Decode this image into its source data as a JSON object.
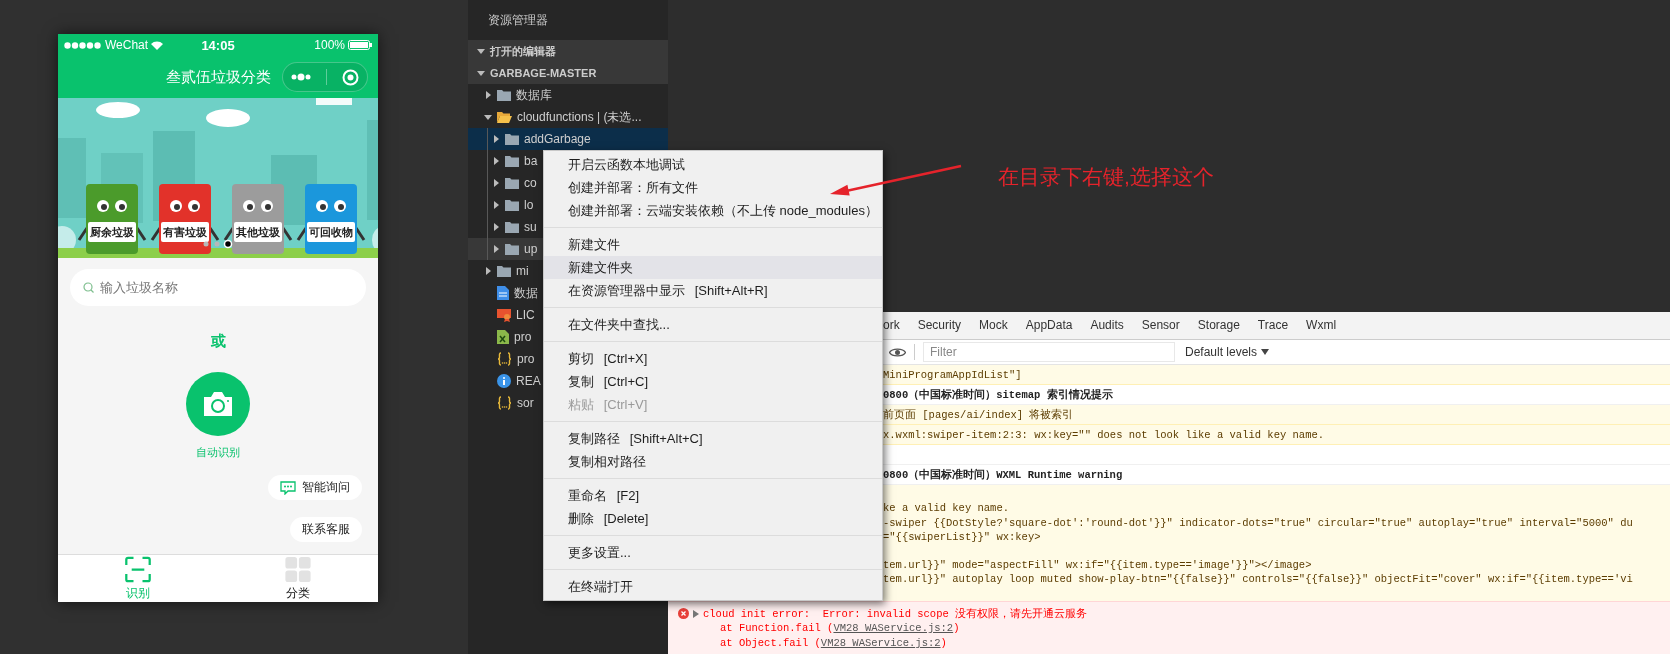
{
  "phone": {
    "status_bar": {
      "carrier": "WeChat",
      "time": "14:05",
      "battery": "100%"
    },
    "title": "叁贰伍垃圾分类",
    "banner": {
      "bins": [
        {
          "label": "厨余垃圾",
          "color": "#4b9b2b"
        },
        {
          "label": "有害垃圾",
          "color": "#e2322a"
        },
        {
          "label": "其他垃圾",
          "color": "#9c9c9c"
        },
        {
          "label": "可回收物",
          "color": "#1b97dc"
        }
      ],
      "dots": [
        {
          "selected": false
        },
        {
          "selected": false
        },
        {
          "selected": true
        }
      ]
    },
    "search": {
      "placeholder": "输入垃圾名称"
    },
    "or_text": "或",
    "camera_label": "自动识别",
    "float_buttons": [
      {
        "kind": "chat",
        "label": "智能询问"
      },
      {
        "kind": "plain",
        "label": "联系客服"
      }
    ],
    "tabs": [
      {
        "kind": "scan",
        "label": "识别",
        "selected": true
      },
      {
        "kind": "grid",
        "label": "分类",
        "selected": false
      }
    ]
  },
  "explorer": {
    "title": "资源管理器",
    "sections": [
      {
        "label": "打开的编辑器",
        "expanded": true
      },
      {
        "label": "GARBAGE-MASTER",
        "expanded": true
      }
    ],
    "tree": [
      {
        "name": "数据库",
        "kind": "folder",
        "expanded": false,
        "selected": false,
        "hovered": false
      },
      {
        "name": "cloudfunctions | (未选...",
        "kind": "cloud-folder",
        "expanded": true,
        "selected": false,
        "hovered": false,
        "children": [
          {
            "name": "addGarbage",
            "kind": "folder",
            "expanded": false,
            "selected": true,
            "hovered": false
          },
          {
            "name": "ba",
            "kind": "folder",
            "expanded": false,
            "selected": false,
            "hovered": false
          },
          {
            "name": "co",
            "kind": "folder",
            "expanded": false,
            "selected": false,
            "hovered": false
          },
          {
            "name": "lo",
            "kind": "folder",
            "expanded": false,
            "selected": false,
            "hovered": false
          },
          {
            "name": "su",
            "kind": "folder",
            "expanded": false,
            "selected": false,
            "hovered": false
          },
          {
            "name": "up",
            "kind": "folder",
            "expanded": false,
            "selected": false,
            "hovered": true
          }
        ]
      },
      {
        "name": "mi",
        "kind": "folder",
        "expanded": false,
        "selected": false,
        "hovered": false
      },
      {
        "name": "数据",
        "kind": "doc",
        "selected": false,
        "hovered": false
      },
      {
        "name": "LIC",
        "kind": "license",
        "selected": false,
        "hovered": false
      },
      {
        "name": "pro",
        "kind": "sheet",
        "selected": false,
        "hovered": false
      },
      {
        "name": "pro",
        "kind": "json",
        "selected": false,
        "hovered": false
      },
      {
        "name": "REA",
        "kind": "info",
        "selected": false,
        "hovered": false
      },
      {
        "name": "sor",
        "kind": "json",
        "selected": false,
        "hovered": false
      }
    ]
  },
  "context_menu": {
    "groups": [
      [
        {
          "label": "开启云函数本地调试",
          "disabled": false,
          "hovered": false
        },
        {
          "label": "创建并部署：所有文件",
          "disabled": false,
          "hovered": false
        },
        {
          "label": "创建并部署：云端安装依赖（不上传 node_modules）",
          "disabled": false,
          "hovered": false
        }
      ],
      [
        {
          "label": "新建文件",
          "disabled": false,
          "hovered": false
        },
        {
          "label": "新建文件夹",
          "disabled": false,
          "hovered": true
        },
        {
          "label": "在资源管理器中显示",
          "shortcut": "[Shift+Alt+R]",
          "disabled": false,
          "hovered": false
        }
      ],
      [
        {
          "label": "在文件夹中查找...",
          "disabled": false,
          "hovered": false
        }
      ],
      [
        {
          "label": "剪切",
          "shortcut": "[Ctrl+X]",
          "disabled": false,
          "hovered": false
        },
        {
          "label": "复制",
          "shortcut": "[Ctrl+C]",
          "disabled": false,
          "hovered": false
        },
        {
          "label": "粘贴",
          "shortcut": "[Ctrl+V]",
          "disabled": true,
          "hovered": false
        }
      ],
      [
        {
          "label": "复制路径",
          "shortcut": "[Shift+Alt+C]",
          "disabled": false,
          "hovered": false
        },
        {
          "label": "复制相对路径",
          "disabled": false,
          "hovered": false
        }
      ],
      [
        {
          "label": "重命名",
          "shortcut": "[F2]",
          "disabled": false,
          "hovered": false
        },
        {
          "label": "删除",
          "shortcut": "[Delete]",
          "disabled": false,
          "hovered": false
        }
      ],
      [
        {
          "label": "更多设置...",
          "disabled": false,
          "hovered": false
        }
      ],
      [
        {
          "label": "在终端打开",
          "disabled": false,
          "hovered": false
        }
      ]
    ]
  },
  "console": {
    "tabs": [
      {
        "label": "ork",
        "selected": false
      },
      {
        "label": "Security",
        "selected": false
      },
      {
        "label": "Mock",
        "selected": false
      },
      {
        "label": "AppData",
        "selected": false
      },
      {
        "label": "Audits",
        "selected": false
      },
      {
        "label": "Sensor",
        "selected": false
      },
      {
        "label": "Storage",
        "selected": false
      },
      {
        "label": "Trace",
        "selected": false
      },
      {
        "label": "Wxml",
        "selected": false
      }
    ],
    "filter": {
      "placeholder": "Filter"
    },
    "levels": "Default levels",
    "entries": [
      {
        "kind": "warning",
        "lines": [
          "MiniProgramAppIdList\"]"
        ]
      },
      {
        "kind": "heading",
        "lines": [
          "0800（中国标准时间）sitemap 索引情况提示"
        ]
      },
      {
        "kind": "warning",
        "lines": [
          "前页面 [pages/ai/index] 将被索引"
        ]
      },
      {
        "kind": "warning",
        "lines": [
          "x.wxml:swiper-item:2:3: wx:key=\"\" does not look like a valid key name."
        ]
      },
      {
        "kind": "blank"
      },
      {
        "kind": "heading",
        "lines": [
          "0800（中国标准时间）WXML Runtime warning"
        ]
      },
      {
        "kind": "code",
        "paragraphs": [
          [
            "ke a valid key name.",
            "-swiper {{DotStyle?'square-dot':'round-dot'}}\" indicator-dots=\"true\" circular=\"true\" autoplay=\"true\" interval=\"5000\" du",
            "=\"{{swiperList}}\" wx:key>"
          ],
          [
            "tem.url}}\" mode=\"aspectFill\" wx:if=\"{{item.type=='image'}}\"></image>",
            "tem.url}}\" autoplay loop muted show-play-btn=\"{{false}}\" controls=\"{{false}}\" objectFit=\"cover\" wx:if=\"{{item.type=='vi"
          ]
        ]
      }
    ],
    "error": {
      "message": "cloud init error:  Error: invalid scope 没有权限，请先开通云服务",
      "stack": [
        {
          "prefix": "at Function.fail (",
          "link": "VM28 WAService.js:2",
          "suffix": ")"
        },
        {
          "prefix": "at Object.fail (",
          "link": "VM28 WAService.js:2",
          "suffix": ")"
        }
      ]
    }
  },
  "annotation": {
    "text": "在目录下右键,选择这个"
  }
}
